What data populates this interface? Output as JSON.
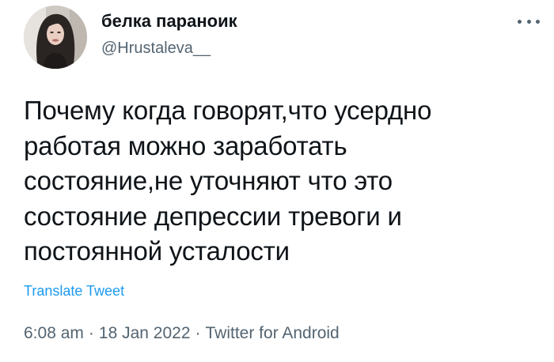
{
  "author": {
    "display_name": "белка параноик",
    "handle": "@Hrustaleva__",
    "avatar_icon": "profile-photo"
  },
  "more_icon": "more-horizontal-icon",
  "tweet": {
    "lines": [
      "Почему когда говорят,что усердно",
      "работая можно заработать",
      "состояние,не уточняют что это",
      "состояние депрессии тревоги и",
      "постоянной усталости"
    ]
  },
  "translate_label": "Translate Tweet",
  "meta": {
    "time": "6:08 am",
    "separator": "·",
    "date": "18 Jan 2022",
    "source": "Twitter for Android"
  },
  "colors": {
    "text": "#0f1419",
    "secondary": "#536471",
    "link": "#1d9bf0"
  }
}
